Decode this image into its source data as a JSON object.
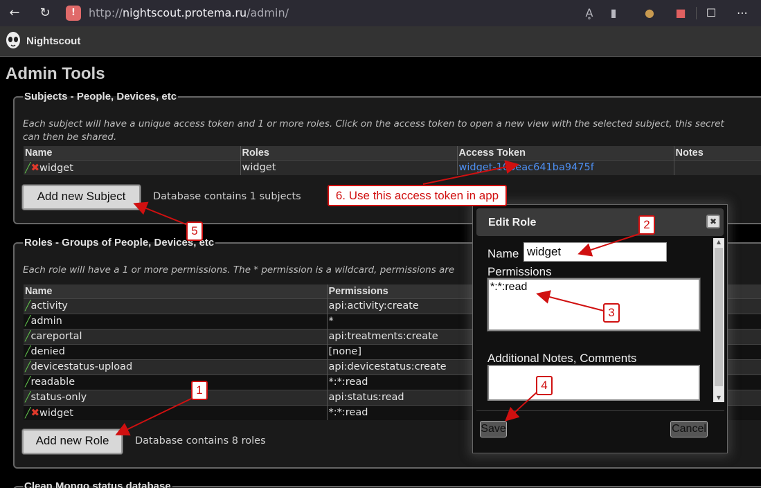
{
  "browser": {
    "back_icon": "back-arrow-icon",
    "reload_icon": "reload-icon",
    "url_prefix": "http://",
    "url_host": "nightscout.protema.ru",
    "url_path": "/admin/"
  },
  "site": {
    "title": "Nightscout"
  },
  "page": {
    "title": "Admin Tools"
  },
  "subjects": {
    "legend": "Subjects - People, Devices, etc",
    "description_line1": "Each subject will have a unique access token and 1 or more roles. Click on the access token to open a new view with the selected subject, this secret",
    "description_line2": "can then be shared.",
    "columns": [
      "Name",
      "Roles",
      "Access Token",
      "Notes"
    ],
    "rows": [
      {
        "name": "widget",
        "roles": "widget",
        "token": "widget-106eac641ba9475f",
        "notes": ""
      }
    ],
    "add_button": "Add new Subject",
    "count_text": "Database contains 1 subjects"
  },
  "roles": {
    "legend": "Roles - Groups of People, Devices, etc",
    "description": "Each role will have a 1 or more permissions. The * permission is a wildcard, permissions are",
    "columns": [
      "Name",
      "Permissions"
    ],
    "rows": [
      {
        "name": "activity",
        "permissions": "api:activity:create"
      },
      {
        "name": "admin",
        "permissions": "*"
      },
      {
        "name": "careportal",
        "permissions": "api:treatments:create"
      },
      {
        "name": "denied",
        "permissions": "[none]"
      },
      {
        "name": "devicestatus-upload",
        "permissions": "api:devicestatus:create"
      },
      {
        "name": "readable",
        "permissions": "*:*:read"
      },
      {
        "name": "status-only",
        "permissions": "api:status:read"
      },
      {
        "name": "widget",
        "permissions": "*:*:read"
      }
    ],
    "add_button": "Add new Role",
    "count_text": "Database contains 8 roles"
  },
  "clean": {
    "legend": "Clean Mongo status database"
  },
  "dialog": {
    "title": "Edit Role",
    "name_label": "Name",
    "name_value": "widget",
    "permissions_label": "Permissions",
    "permissions_value": "*:*:read",
    "notes_label": "Additional Notes, Comments",
    "notes_value": "",
    "save": "Save",
    "cancel": "Cancel"
  },
  "annotations": {
    "c1": "1",
    "c2": "2",
    "c3": "3",
    "c4": "4",
    "c5": "5",
    "c6": "6. Use this access token in app",
    "color": "#d01010"
  }
}
